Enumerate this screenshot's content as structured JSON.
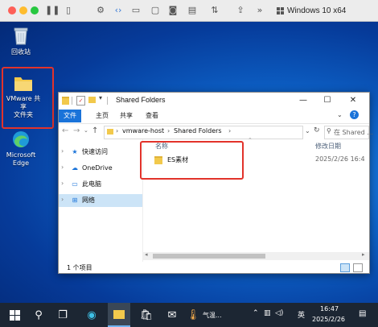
{
  "vm": {
    "title": "Windows 10 x64"
  },
  "desktop": {
    "icons": [
      {
        "label": "回收站"
      },
      {
        "label": "VMware 共享\n文件夹"
      },
      {
        "label": "Microsoft\nEdge"
      }
    ]
  },
  "explorer": {
    "title": "Shared Folders",
    "tabs": [
      "文件",
      "主页",
      "共享",
      "查看"
    ],
    "breadcrumb": [
      "vmware-host",
      "Shared Folders"
    ],
    "search_placeholder": "在 Shared ...",
    "nav": [
      "快速访问",
      "OneDrive",
      "此电脑",
      "网络"
    ],
    "columns": {
      "name": "名称",
      "modified": "修改日期"
    },
    "rows": [
      {
        "name": "ES素材",
        "modified": "2025/2/26 16:4"
      }
    ],
    "status": "1 个项目"
  },
  "taskbar": {
    "weather": "气温...",
    "lang": "英",
    "time": "16:47",
    "date": "2025/2/26"
  },
  "colors": {
    "accent": "#1a73d9",
    "highlight": "#e2332b",
    "taskbar": "#1c2633"
  }
}
